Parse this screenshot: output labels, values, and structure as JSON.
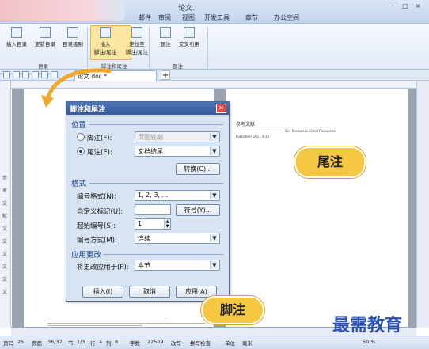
{
  "window": {
    "title": "论文.doc - WPS 文字",
    "title_visible": "论文.",
    "controls": [
      "–",
      "□",
      "×"
    ]
  },
  "ribbon": {
    "tabs": [
      "邮件",
      "审阅",
      "视图",
      "开发工具",
      "章节",
      "办公空间"
    ],
    "buttons": [
      {
        "label": "插入目录"
      },
      {
        "label": "更新目录"
      },
      {
        "label": "目录级别"
      },
      {
        "label": "插入\n脚注/尾注"
      },
      {
        "label": "定位至\n脚注/尾注"
      },
      {
        "label": "题注"
      },
      {
        "label": "交叉引用"
      }
    ],
    "groups": [
      "目录",
      "脚注和尾注",
      "题注"
    ]
  },
  "doc_tab": {
    "label": "论文.doc *"
  },
  "vruler_chars": [
    "参",
    "考",
    "文",
    "献",
    "文",
    "文",
    "文",
    "文",
    "文",
    "文"
  ],
  "page2": {
    "heading": "参考文献",
    "ref_line1": "Publishers 2011 8-10",
    "ref_visible_text": "See Resources Client Resources"
  },
  "dialog": {
    "title": "脚注和尾注",
    "close": "×",
    "position_section": "位置",
    "footnote_label": "脚注(F):",
    "footnote_value": "页面底端",
    "endnote_label": "尾注(E):",
    "endnote_value": "文档结尾",
    "convert_button": "转换(C)...",
    "format_section": "格式",
    "number_format_label": "编号格式(N):",
    "number_format_value": "1, 2, 3, ...",
    "custom_mark_label": "自定义标记(U):",
    "symbol_button": "符号(Y)...",
    "start_at_label": "起始编号(S):",
    "start_at_value": "1",
    "numbering_label": "编号方式(M):",
    "numbering_value": "连续",
    "apply_section": "应用更改",
    "apply_to_label": "将更改应用于(P):",
    "apply_to_value": "本节",
    "insert_button": "插入(I)",
    "cancel_button": "取消",
    "apply_button": "应用(A)"
  },
  "callouts": {
    "endnote": "尾注",
    "footnote": "脚注"
  },
  "watermark": "最需教育",
  "statusbar": {
    "items": [
      "页码",
      "25",
      "页面",
      "36/37",
      "节",
      "1/3",
      "行",
      "4",
      "列",
      "8",
      "字数",
      "22509",
      "改写",
      "拼写检查",
      "单位",
      "毫米"
    ],
    "zoom": "50 %"
  },
  "colors": {
    "dialog_title": "#35589a",
    "callout": "#f6c743",
    "watermark": "#2a4fb0"
  }
}
